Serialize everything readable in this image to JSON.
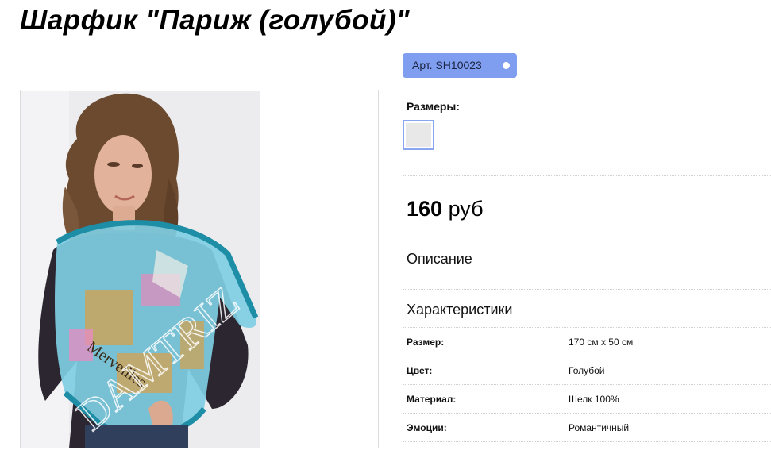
{
  "product": {
    "title": "Шарфик \"Париж (голубой)\"",
    "sku": "Арт. SH10023",
    "sizes_label": "Размеры:",
    "price_value": "160",
    "price_currency": "руб"
  },
  "sections": {
    "description": "Описание",
    "characteristics": "Характеристики"
  },
  "specs": [
    {
      "key": "Размер:",
      "value": "170 см х 50 см"
    },
    {
      "key": "Цвет:",
      "value": "Голубой"
    },
    {
      "key": "Материал:",
      "value": "Шелк 100%"
    },
    {
      "key": "Эмоции:",
      "value": "Романтичный"
    }
  ],
  "photo": {
    "scarf_text": "Merveilles",
    "watermark": "DAMTRIZ"
  },
  "colors": {
    "sku_badge": "#7f9ef0",
    "swatch_border": "#8aa6f0",
    "scarf": "#6fc3dc",
    "scarf_border": "#1e8da6"
  }
}
